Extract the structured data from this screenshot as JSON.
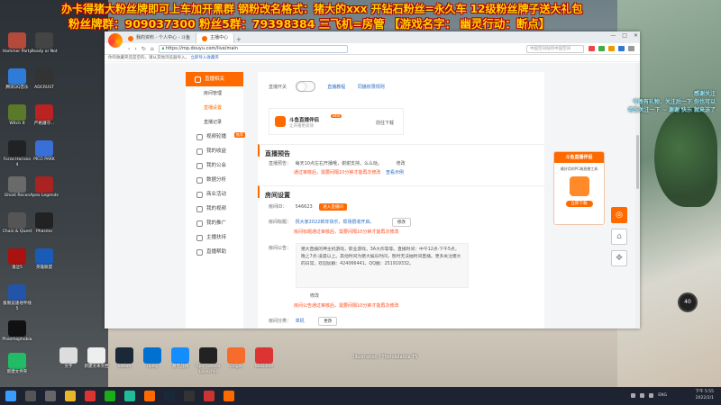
{
  "banner": {
    "line1": "办卡得猪大粉丝牌即可上车加开黑群   钢粉改名格式：猪大的xxx   开钻石粉丝=永久车   12级粉丝牌子送大礼包",
    "line2": "粉丝牌群：909037300 粉丝5群：79398384   三飞机=房管   【游戏名字：  幽灵行动：断点】"
  },
  "desktop_icons": [
    {
      "label": "Hammer Party",
      "color": "#b34a3a"
    },
    {
      "label": "Ready or Not",
      "color": "#444"
    },
    {
      "label": "腾讯QQ音乐",
      "color": "#2f7bd8"
    },
    {
      "label": "ADCRUST",
      "color": "#333"
    },
    {
      "label": "Witch It",
      "color": "#5a7a2a"
    },
    {
      "label": "严格遵守...",
      "color": "#b22"
    },
    {
      "label": "Forza Horizon 4",
      "color": "#222"
    },
    {
      "label": "PICO PARK",
      "color": "#3a6fd8"
    },
    {
      "label": "Ghost Recon",
      "color": "#6a6a6a"
    },
    {
      "label": "Apex Legends",
      "color": "#a22"
    },
    {
      "label": "Chain & Quest",
      "color": "#555"
    },
    {
      "label": "Phasmo",
      "color": "#222"
    },
    {
      "label": "鬼泣5",
      "color": "#a11"
    },
    {
      "label": "极限竞速地平线5",
      "color": "#2255aa"
    },
    {
      "label": "Phasmophobia",
      "color": "#111"
    },
    {
      "label": "英雄联盟",
      "color": "#1b5bb8"
    }
  ],
  "taskbar_desktop": [
    {
      "label": "新建文件夹",
      "color": "#2b6"
    },
    {
      "label": "文字",
      "color": "#ddd"
    },
    {
      "label": "新建文本文档",
      "color": "#eee"
    },
    {
      "label": "Steam",
      "color": "#1b2838"
    },
    {
      "label": "Uplay",
      "color": "#0070d1"
    },
    {
      "label": "暴雪战网",
      "color": "#148eff"
    },
    {
      "label": "Epic Games Launcher",
      "color": "#222"
    },
    {
      "label": "Origin",
      "color": "#f56c2d"
    },
    {
      "label": "WeGame",
      "color": "#d33"
    }
  ],
  "browser": {
    "tabs": [
      {
        "label": "我的资料 - 个人中心 - 斗鱼",
        "active": false
      },
      {
        "label": "主播中心",
        "active": true
      }
    ],
    "address": "https://mp.douyu.com/live/main",
    "search_placeholder": "中国空间站的中国空间",
    "bookmark_text": "你的收藏夹还是空的，请从其他浏览器导入。",
    "bookmark_link": "立即导入收藏夹"
  },
  "sidebar": {
    "items": [
      {
        "label": "直播相关",
        "type": "head"
      },
      {
        "label": "房间管理",
        "type": "sub"
      },
      {
        "label": "直播设置",
        "type": "sub",
        "selected": true
      },
      {
        "label": "直播记录",
        "type": "sub"
      },
      {
        "label": "视频轮播",
        "type": "item",
        "badge": "推荐"
      },
      {
        "label": "我的收益",
        "type": "item"
      },
      {
        "label": "我的公会",
        "type": "item"
      },
      {
        "label": "数据分析",
        "type": "item"
      },
      {
        "label": "商业活动",
        "type": "item"
      },
      {
        "label": "我的视频",
        "type": "item"
      },
      {
        "label": "我的推广",
        "type": "item"
      },
      {
        "label": "主播扶持",
        "type": "item"
      },
      {
        "label": "直播帮助",
        "type": "item"
      }
    ]
  },
  "main": {
    "live_switch_label": "直播开关",
    "live_tutorial": "直播教程",
    "live_rules": "同播权限规则",
    "promo_title": "斗鱼直播伴侣",
    "promo_sub": "让开播更高效",
    "promo_new": "NEW",
    "promo_download": "前往下载",
    "preview_title": "直播预告",
    "preview_label": "直播预告：",
    "preview_value": "每天10点左右开播哦，谢谢支持。么么哒。",
    "preview_edit": "修改",
    "preview_warn": "通过审核后，需要间隔10分钟才能再次修改",
    "preview_example": "查看示例",
    "room_title": "房间设置",
    "room_id_label": "房间ID：",
    "room_id_value": "546623",
    "room_id_btn": "进入直播间",
    "room_name_label": "房间标题：",
    "room_name_value": "祝大家2022新年快乐，现场把收开启。",
    "room_name_edit": "修改",
    "room_name_warn": "房间标题通过审核后，需要间隔10分钟才能再次修改",
    "notice_label": "房间公告：",
    "notice_value": "猪大直播的神主机游戏，职业游戏，3A大作等等。直播时间：中午12点-下午5点，晚上7点-凌晨以上。其他时间为猪大娱乐时间，暂时无法抽时间直播。更多关注猪大的日常，欢迎加群：424066441，QQ群：251919332。",
    "notice_edit": "修改",
    "notice_warn": "房间公告通过审核后，需要间隔10分钟才能再次修改",
    "category_label": "房间分类：",
    "category_value": "单机",
    "category_edit": "更改"
  },
  "right_panel": {
    "header": "斗鱼直播伴侣",
    "text": "最好用的PC端直播工具",
    "button": "立即下载"
  },
  "overlay": {
    "line1": "感谢关注",
    "line2": "今晚有礼物，关注后一下 你也可以",
    "line3": "老铁关注一下 ~ 谢谢 快乐 就来送了"
  },
  "gauge": "40",
  "credit": "Illustration | Thomsdance T5",
  "tray": {
    "time": "下午 5:55",
    "date": "2022/2/1",
    "lang": "ENG"
  }
}
